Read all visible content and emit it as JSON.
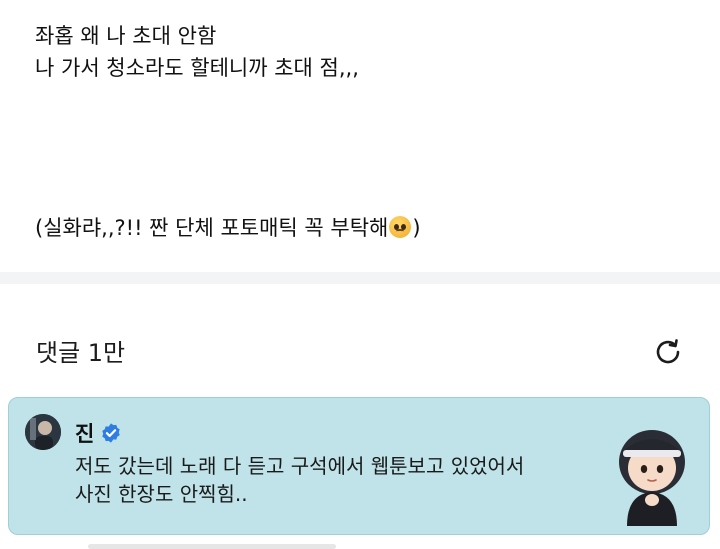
{
  "post": {
    "lines": [
      "좌홉 왜 나 초대 안함",
      "나 가서 청소라도 할테니까 초대 점,,,"
    ],
    "footer_line_text": "(실화랴,,?!! 짠 단체 포토매틱 꼭 부탁해",
    "footer_line_end": ")",
    "emoji": "pleading-face-emoji"
  },
  "comments": {
    "header": "댓글 1만",
    "refresh_icon": "refresh-icon",
    "highlighted": {
      "author": "진",
      "verified_icon": "verified-badge-icon",
      "lines": [
        "저도 갔는데 노래 다 듣고 구석에서 웹툰보고 있었어서",
        "사진 한장도 안찍힘.."
      ],
      "sticker": "character-sticker",
      "background": "#bfe3e9"
    }
  },
  "colors": {
    "accent_blue": "#2f7de1",
    "divider": "#f2f4f6"
  }
}
